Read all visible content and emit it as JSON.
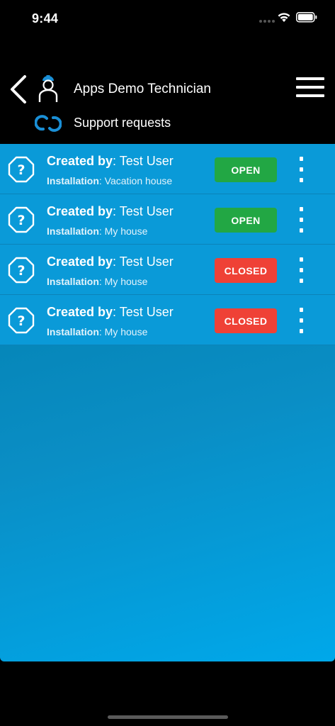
{
  "status_bar": {
    "time": "9:44"
  },
  "header": {
    "app_title": "Apps Demo Technician",
    "section_title": "Support requests"
  },
  "colors": {
    "open": "#22a744",
    "closed": "#ef4136"
  },
  "requests": [
    {
      "created_label": "Created by",
      "created_value": ": Test User",
      "installation_label": "Installation",
      "installation_value": ": Vacation house",
      "status": "OPEN",
      "status_key": "open"
    },
    {
      "created_label": "Created by",
      "created_value": ": Test User",
      "installation_label": "Installation",
      "installation_value": ": My house",
      "status": "OPEN",
      "status_key": "open"
    },
    {
      "created_label": "Created by",
      "created_value": ": Test User",
      "installation_label": "Installation",
      "installation_value": ": My house",
      "status": "CLOSED",
      "status_key": "closed"
    },
    {
      "created_label": "Created by",
      "created_value": ": Test User",
      "installation_label": "Installation",
      "installation_value": ": My house",
      "status": "CLOSED",
      "status_key": "closed"
    }
  ]
}
